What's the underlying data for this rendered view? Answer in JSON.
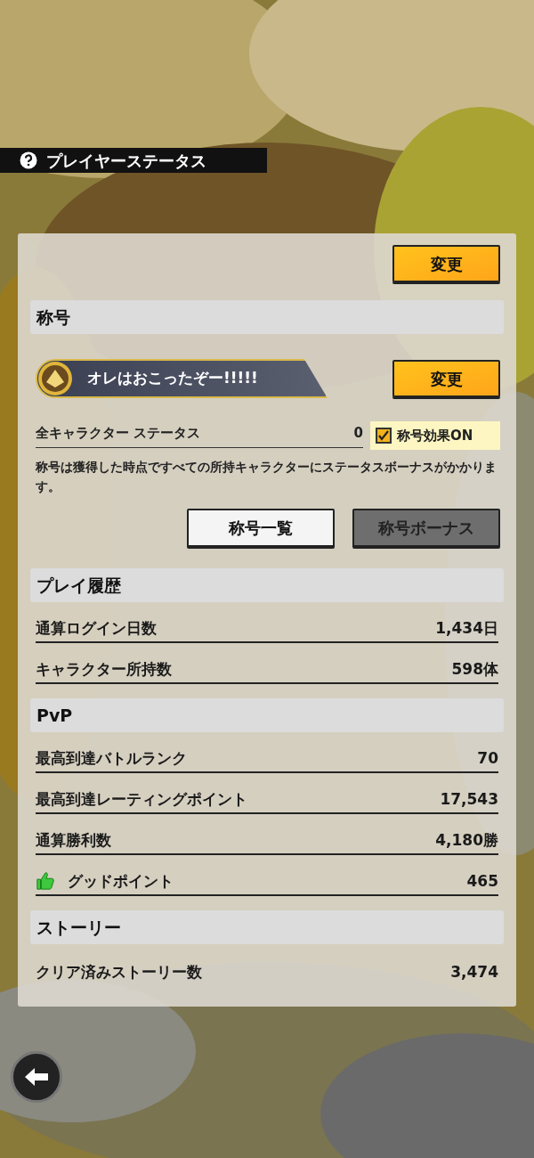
{
  "header": {
    "title": "プレイヤーステータス"
  },
  "top_button": "変更",
  "title_section": {
    "heading": "称号",
    "title_plate": "オレはおこったぞー!!!!!",
    "change_button": "変更",
    "status_label": "全キャラクター ステータス",
    "status_value": "0",
    "effect_toggle": {
      "label": "称号効果ON",
      "checked": true
    },
    "description": "称号は獲得した時点ですべての所持キャラクターにステータスボーナスがかかります。",
    "buttons": [
      {
        "label": "称号一覧",
        "disabled": false
      },
      {
        "label": "称号ボーナス",
        "disabled": true
      }
    ]
  },
  "sections": [
    {
      "heading": "プレイ履歴",
      "rows": [
        {
          "kind": "plain",
          "label": "通算ログイン日数",
          "value": "1,434日"
        },
        {
          "kind": "plain",
          "label": "キャラクター所持数",
          "value": "598体"
        }
      ]
    },
    {
      "heading": "PvP",
      "rows": [
        {
          "kind": "plain",
          "label": "最高到達バトルランク",
          "value": "70"
        },
        {
          "kind": "plain",
          "label": "最高到達レーティングポイント",
          "value": "17,543"
        },
        {
          "kind": "plain",
          "label": "通算勝利数",
          "value": "4,180勝"
        },
        {
          "kind": "good",
          "label": "グッドポイント",
          "value": "465"
        }
      ]
    },
    {
      "heading": "ストーリー",
      "rows": [
        {
          "kind": "plain",
          "label": "クリア済みストーリー数",
          "value": "3,474"
        }
      ]
    }
  ]
}
